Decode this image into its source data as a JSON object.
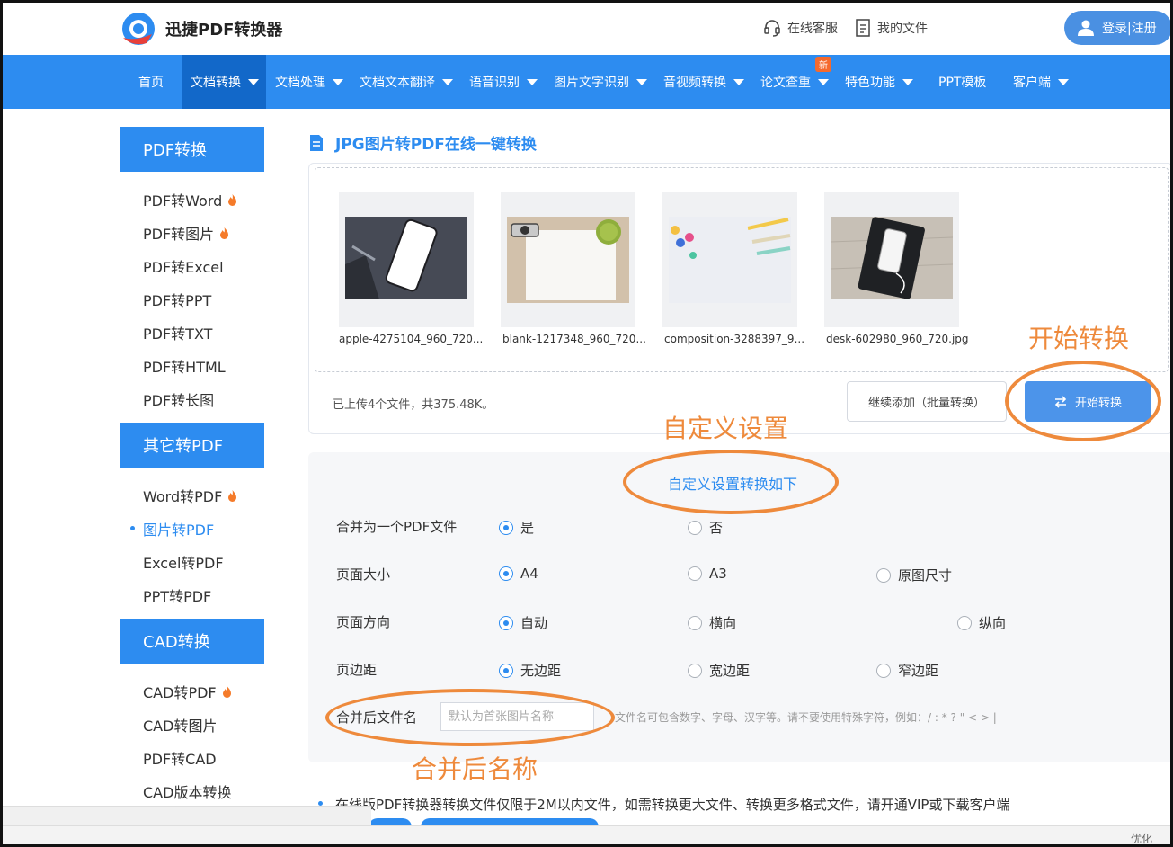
{
  "header": {
    "brand": "迅捷PDF转换器",
    "service": "在线客服",
    "my_files": "我的文件",
    "login": "登录|注册"
  },
  "nav": {
    "items": [
      "首页",
      "文档转换",
      "文档处理",
      "文档文本翻译",
      "语音识别",
      "图片文字识别",
      "音视频转换",
      "论文查重",
      "特色功能",
      "PPT模板",
      "客户端"
    ],
    "badge": "新"
  },
  "sidebar": {
    "groups": [
      {
        "title": "PDF转换",
        "items": [
          "PDF转Word",
          "PDF转图片",
          "PDF转Excel",
          "PDF转PPT",
          "PDF转TXT",
          "PDF转HTML",
          "PDF转长图"
        ]
      },
      {
        "title": "其它转PDF",
        "items": [
          "Word转PDF",
          "图片转PDF",
          "Excel转PDF",
          "PPT转PDF"
        ]
      },
      {
        "title": "CAD转换",
        "items": [
          "CAD转PDF",
          "CAD转图片",
          "PDF转CAD",
          "CAD版本转换"
        ]
      }
    ]
  },
  "main": {
    "title": "JPG图片转PDF在线一键转换",
    "files": [
      {
        "name": "apple-4275104_960_720..."
      },
      {
        "name": "blank-1217348_960_720..."
      },
      {
        "name": "composition-3288397_9..."
      },
      {
        "name": "desk-602980_960_720.jpg"
      }
    ],
    "upload_info": "已上传4个文件，共375.48K。",
    "add_more": "继续添加（批量转换）",
    "start": "开始转换"
  },
  "settings": {
    "title": "自定义设置转换如下",
    "rows": [
      {
        "label": "合并为一个PDF文件",
        "options": [
          "是",
          "否"
        ]
      },
      {
        "label": "页面大小",
        "options": [
          "A4",
          "A3",
          "原图尺寸"
        ]
      },
      {
        "label": "页面方向",
        "options": [
          "自动",
          "横向",
          "纵向"
        ]
      },
      {
        "label": "页边距",
        "options": [
          "无边距",
          "宽边距",
          "窄边距"
        ]
      }
    ],
    "filename_label": "合并后文件名",
    "filename_placeholder": "默认为首张图片名称",
    "filename_hint": "文件名可包含数字、字母、汉字等。请不要使用特殊字符，例如：/ : * ? \" < > |"
  },
  "notice": "在线版PDF转换器转换文件仅限于2M以内文件，如需转换更大文件、转换更多格式文件，请开通VIP或下载客户端",
  "annotations": {
    "start": "开始转换",
    "custom": "自定义设置",
    "name": "合并后名称"
  },
  "watermark": "优化",
  "colors": {
    "primary": "#2d8cf0",
    "annotation": "#ee8a3c"
  }
}
